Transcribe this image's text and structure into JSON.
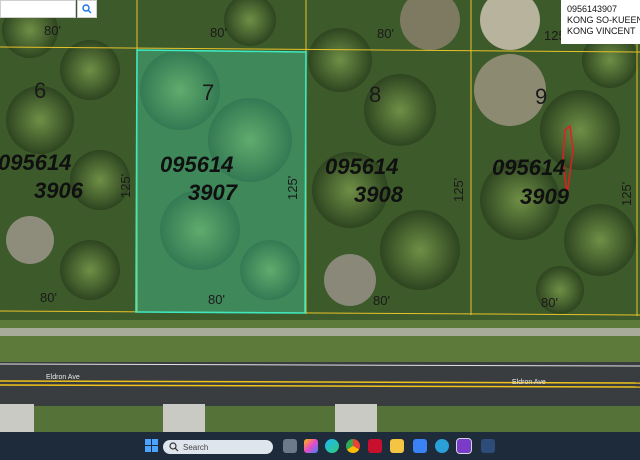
{
  "search": {
    "placeholder": ""
  },
  "owner_info": {
    "parcel_id": "0956143907",
    "owner_line1": "KONG SO-KUEEN",
    "owner_line2": "KONG VINCENT"
  },
  "parcels": [
    {
      "lot": "6",
      "apn_line1": "095614",
      "apn_line2": "3906",
      "side_label": "125'",
      "frontage": "80'"
    },
    {
      "lot": "7",
      "apn_line1": "095614",
      "apn_line2": "3907",
      "side_label": "125'",
      "frontage": "80'"
    },
    {
      "lot": "8",
      "apn_line1": "095614",
      "apn_line2": "3908",
      "side_label": "125'",
      "frontage": "80'"
    },
    {
      "lot": "9",
      "apn_line1": "095614",
      "apn_line2": "3909",
      "side_label": "125'",
      "frontage": "80'"
    }
  ],
  "top_labels": {
    "left_80": "80'",
    "mid_80": "80'",
    "right_80": "80'",
    "right_side": "125'"
  },
  "street": {
    "name_left": "Eldron Ave",
    "name_right": "Eldron Ave"
  },
  "taskbar": {
    "search_label": "Search"
  },
  "colors": {
    "selected_parcel": "#40e8c0",
    "parcel_lines": "#e8c22a",
    "road": "#3a3d40",
    "lane_line": "#f0c419"
  }
}
